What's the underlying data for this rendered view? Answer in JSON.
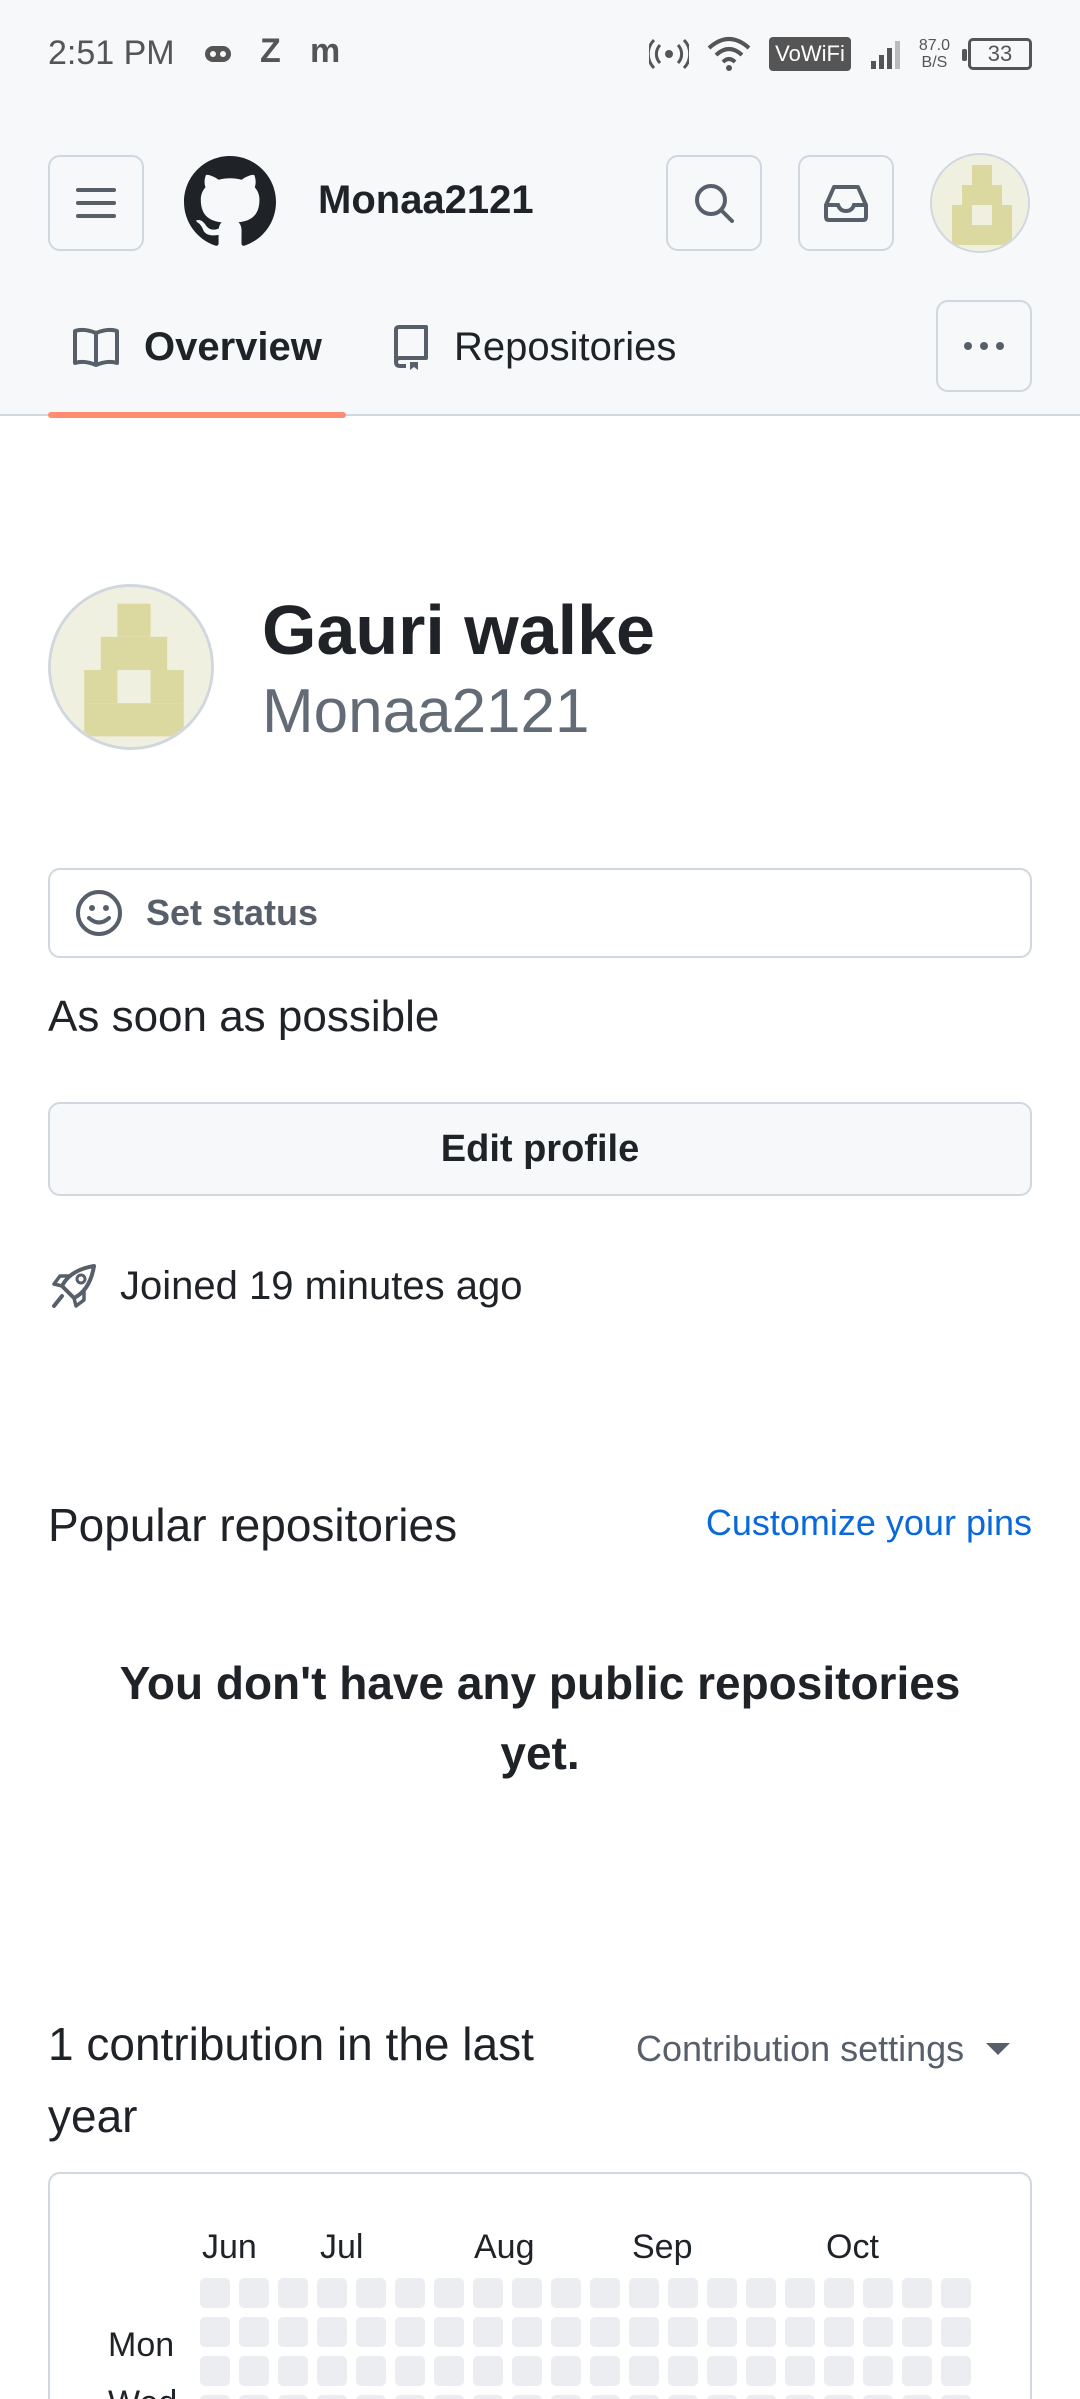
{
  "status_bar": {
    "time": "2:51 PM",
    "app_icons": [
      "Z",
      "m"
    ],
    "vowifi": "VoWiFi",
    "net_speed_value": "87.0",
    "net_speed_unit": "B/S",
    "battery": "33"
  },
  "header": {
    "username": "Monaa2121",
    "tabs": [
      {
        "label": "Overview",
        "selected": true
      },
      {
        "label": "Repositories",
        "selected": false
      }
    ]
  },
  "profile": {
    "name": "Gauri walke",
    "login": "Monaa2121",
    "set_status_label": "Set status",
    "bio": "As soon as possible",
    "edit_profile_label": "Edit profile",
    "joined": "Joined 19 minutes ago"
  },
  "popular": {
    "title": "Popular repositories",
    "customize_label": "Customize your pins",
    "empty_message": "You don't have any public repositories yet."
  },
  "contributions": {
    "title": "1 contribution in the last year",
    "settings_label": "Contribution settings",
    "months": [
      "Jun",
      "Jul",
      "Aug",
      "Sep",
      "Oct"
    ],
    "day_labels": [
      "Mon",
      "Wed"
    ]
  },
  "colors": {
    "accent_tab": "#fd8c73",
    "link": "#0969da",
    "avatar_tile": "#dcd9a0",
    "empty_cell": "#ebedf0"
  }
}
